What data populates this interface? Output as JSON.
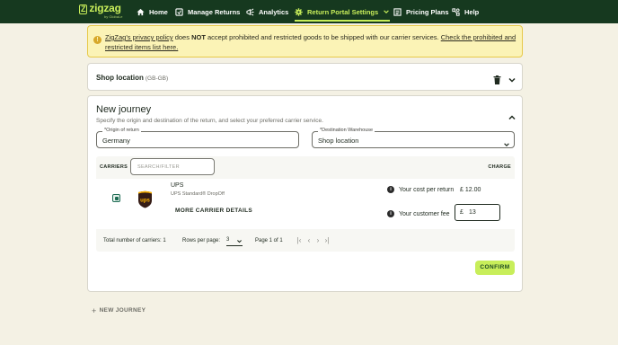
{
  "nav": {
    "logo_text": "zigzag",
    "logo_subtext": "by Global-e",
    "items": [
      {
        "label": "Home",
        "icon": "home-icon"
      },
      {
        "label": "Manage Returns",
        "icon": "returns-icon"
      },
      {
        "label": "Analytics",
        "icon": "analytics-icon"
      },
      {
        "label": "Return Portal Settings",
        "icon": "gear-icon"
      },
      {
        "label": "Pricing Plans",
        "icon": "pricing-icon"
      },
      {
        "label": "Help",
        "icon": "help-icon"
      }
    ]
  },
  "banner": {
    "link_text": "ZigZag's privacy policy",
    "text_pre": " does ",
    "text_bold": "NOT",
    "text_post": " accept prohibited and restricted goods to be shipped with our carrier services. ",
    "link2_text": "Check the prohibited and restricted items list here."
  },
  "shop_location": {
    "title": "Shop location",
    "code": "(GB-GB)"
  },
  "journey": {
    "title": "New journey",
    "description": "Specify the origin and destination of the return, and select your preferred carrier service.",
    "origin": {
      "label": "*Origin of return",
      "value": "Germany"
    },
    "destination": {
      "label": "*Destination Warehouse",
      "value": "Shop location"
    },
    "carriers_label": "CARRIERS",
    "search_placeholder": "SEARCH/FILTER",
    "charge_label": "CHARGE",
    "carrier": {
      "name": "UPS",
      "service": "UPS Standard® DropOff",
      "more_details": "MORE CARRIER DETAILS",
      "cost_label": "Your cost per return",
      "cost_value": "£  12.00",
      "fee_label": "Your customer fee",
      "fee_currency": "£",
      "fee_value": "13",
      "selected": true
    },
    "pager": {
      "total": "Total number of carriers: 1",
      "rows_label": "Rows per page:",
      "rows_value": "3",
      "page_text": "Page 1 of 1"
    },
    "confirm_label": "CONFIRM"
  },
  "new_journey_label": "NEW JOURNEY",
  "colors": {
    "nav_bg": "#16391f",
    "accent": "#c8ee5a",
    "banner_bg": "#fbf3b6",
    "page_bg": "#f4f1e4",
    "ups_brown": "#351c15",
    "ups_gold": "#ffb500"
  }
}
